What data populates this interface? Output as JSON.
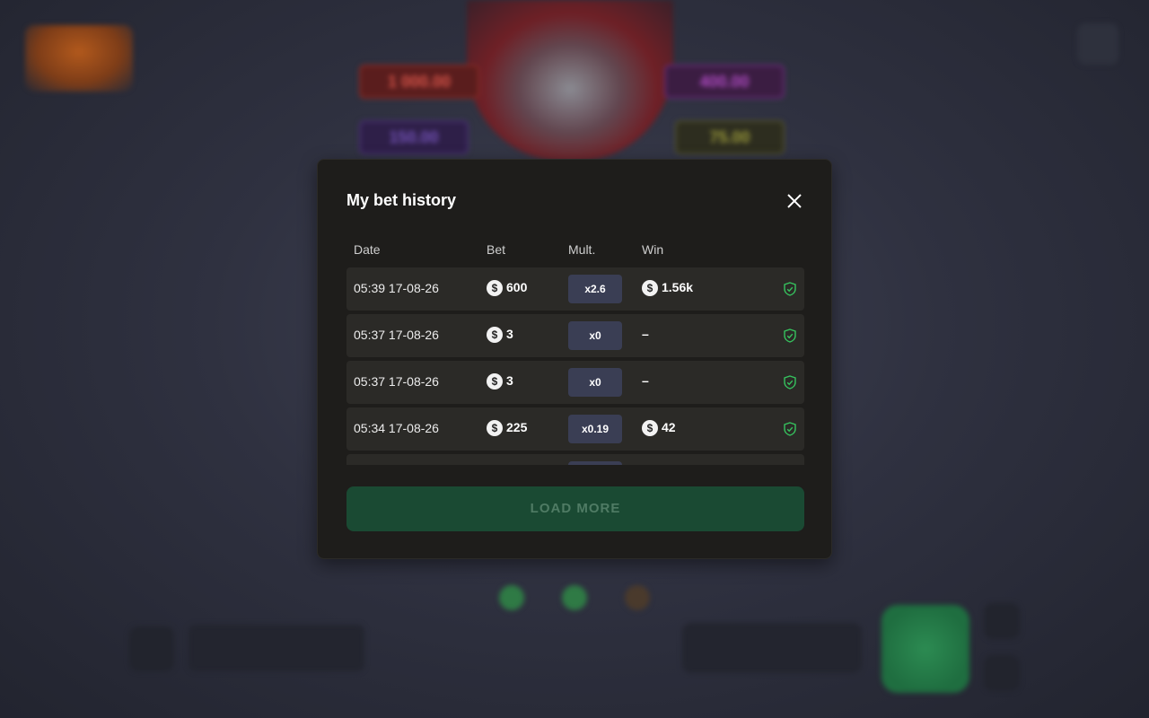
{
  "modal": {
    "title": "My bet history",
    "columns": {
      "date": "Date",
      "bet": "Bet",
      "mult": "Mult.",
      "win": "Win"
    },
    "rows": [
      {
        "date": "05:39 17-08-26",
        "bet": "600",
        "mult": "x2.6",
        "win": "1.56k",
        "win_coin": true
      },
      {
        "date": "05:37 17-08-26",
        "bet": "3",
        "mult": "x0",
        "win": "–",
        "win_coin": false
      },
      {
        "date": "05:37 17-08-26",
        "bet": "3",
        "mult": "x0",
        "win": "–",
        "win_coin": false
      },
      {
        "date": "05:34 17-08-26",
        "bet": "225",
        "mult": "x0.19",
        "win": "42",
        "win_coin": true
      }
    ],
    "coin_symbol": "$",
    "load_more_label": "LOAD MORE"
  },
  "background": {
    "jackpots": [
      {
        "value": "1 000.00",
        "color": "#c8443a"
      },
      {
        "value": "400.00",
        "color": "#a23fb4"
      },
      {
        "value": "150.00",
        "color": "#6b3fb4"
      },
      {
        "value": "75.00",
        "color": "#8a8a2a"
      }
    ]
  },
  "colors": {
    "modal_bg": "#1e1d1b",
    "row_bg": "#2b2a27",
    "mult_badge": "#3a3e54",
    "load_more_bg": "#1a4a33",
    "shield_green": "#36c25e"
  },
  "icons": [
    "close-icon",
    "shield-check-icon",
    "coin-icon"
  ]
}
